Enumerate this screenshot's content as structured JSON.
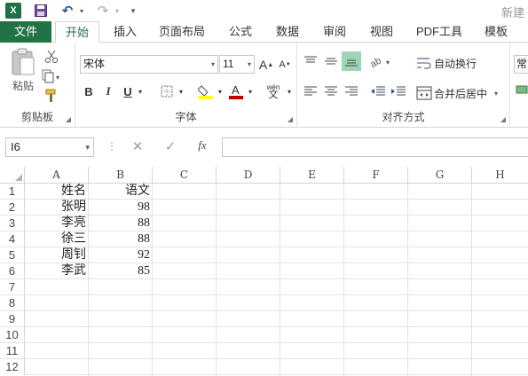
{
  "titlebar": {
    "app_icon": "X",
    "doc_title": "新建",
    "icons": [
      "excel-icon",
      "save-icon",
      "undo-icon",
      "redo-icon",
      "customize-qat-icon"
    ]
  },
  "tabs": [
    {
      "label": "文件"
    },
    {
      "label": "开始"
    },
    {
      "label": "插入"
    },
    {
      "label": "页面布局"
    },
    {
      "label": "公式"
    },
    {
      "label": "数据"
    },
    {
      "label": "审阅"
    },
    {
      "label": "视图"
    },
    {
      "label": "PDF工具"
    },
    {
      "label": "模板"
    }
  ],
  "clipboard": {
    "paste_label": "粘贴",
    "group_label": "剪贴板"
  },
  "font": {
    "name": "宋体",
    "size": "11",
    "bold": "B",
    "italic": "I",
    "underline": "U",
    "phonetic": "wén",
    "group_label": "字体"
  },
  "alignment": {
    "wrap_text": "自动换行",
    "merge_center": "合并后居中",
    "group_label": "对齐方式"
  },
  "number": {
    "format_partial": "常"
  },
  "formula_bar": {
    "name_box": "I6",
    "fx_label": "fx",
    "cancel_symbol": "✕",
    "enter_symbol": "✓",
    "formula": ""
  },
  "sheet": {
    "columns": [
      "A",
      "B",
      "C",
      "D",
      "E",
      "F",
      "G",
      "H"
    ],
    "rows": [
      "1",
      "2",
      "3",
      "4",
      "5",
      "6",
      "7",
      "8",
      "9",
      "10",
      "11",
      "12"
    ],
    "cells": [
      [
        "姓名",
        "语文"
      ],
      [
        "张明",
        "98"
      ],
      [
        "李亮",
        "88"
      ],
      [
        "徐三",
        "88"
      ],
      [
        "周钊",
        "92"
      ],
      [
        "李武",
        "85"
      ]
    ]
  },
  "colors": {
    "brand_green": "#217346",
    "active_align": "#9fd5b7",
    "font_color_red": "#c00000",
    "fill_yellow": "#ffff00"
  }
}
